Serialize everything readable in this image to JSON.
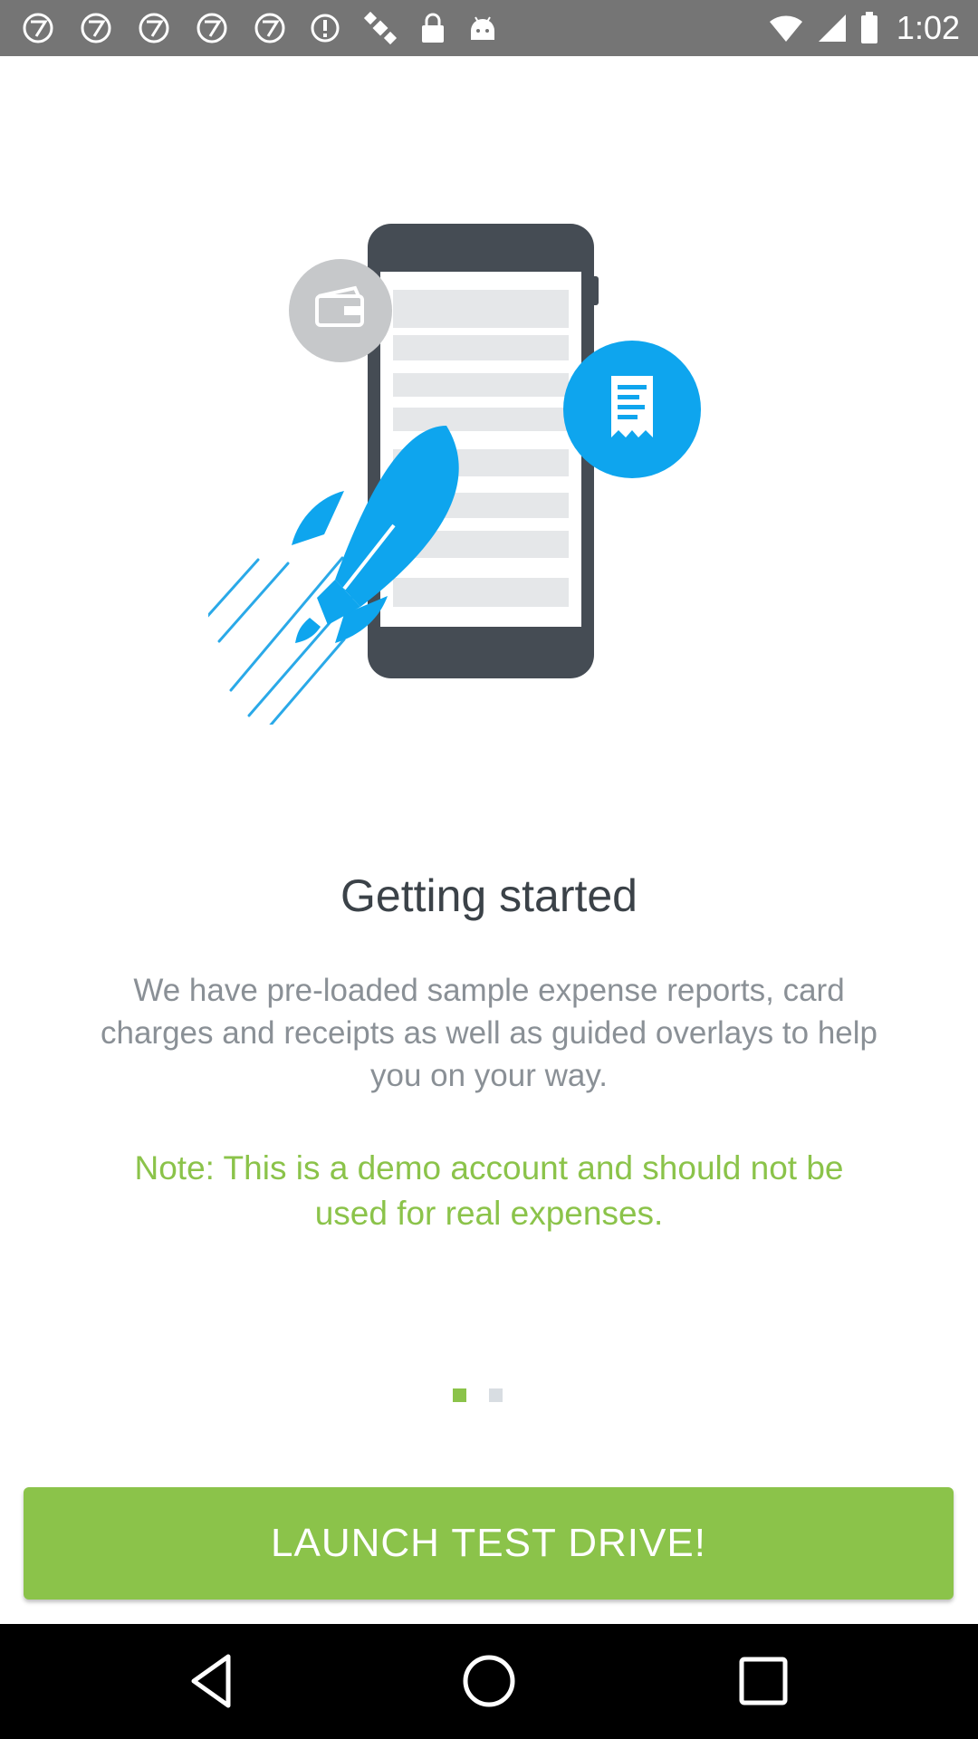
{
  "status_bar": {
    "time": "1:02",
    "icons": [
      "abc7-icon",
      "abc7-icon",
      "abc7-icon",
      "abc7-icon",
      "abc7-icon",
      "alert-icon",
      "satellite-icon",
      "lock-icon",
      "android-icon"
    ],
    "right_icons": [
      "wifi-icon",
      "signal-icon",
      "battery-icon"
    ]
  },
  "illustration": {
    "elements": [
      "phone-icon",
      "wallet-icon",
      "receipt-icon",
      "rocket-icon"
    ],
    "colors": {
      "accent_blue": "#0ea5ee",
      "phone_dark": "#454c54",
      "gray_circle": "#c6c8ca"
    }
  },
  "content": {
    "title": "Getting started",
    "description": "We have pre-loaded sample expense reports, card charges and receipts as well as guided overlays to help you on your way.",
    "note": "Note: This is a demo account and should not be used for real expenses."
  },
  "pager": {
    "current": 1,
    "total": 2
  },
  "button": {
    "label": "LAUNCH TEST DRIVE!"
  },
  "colors": {
    "brand_green": "#8bc34a",
    "title_text": "#3b4248",
    "body_text": "#8a9096"
  },
  "nav_bar": {
    "buttons": [
      "back-icon",
      "home-icon",
      "recents-icon"
    ]
  }
}
